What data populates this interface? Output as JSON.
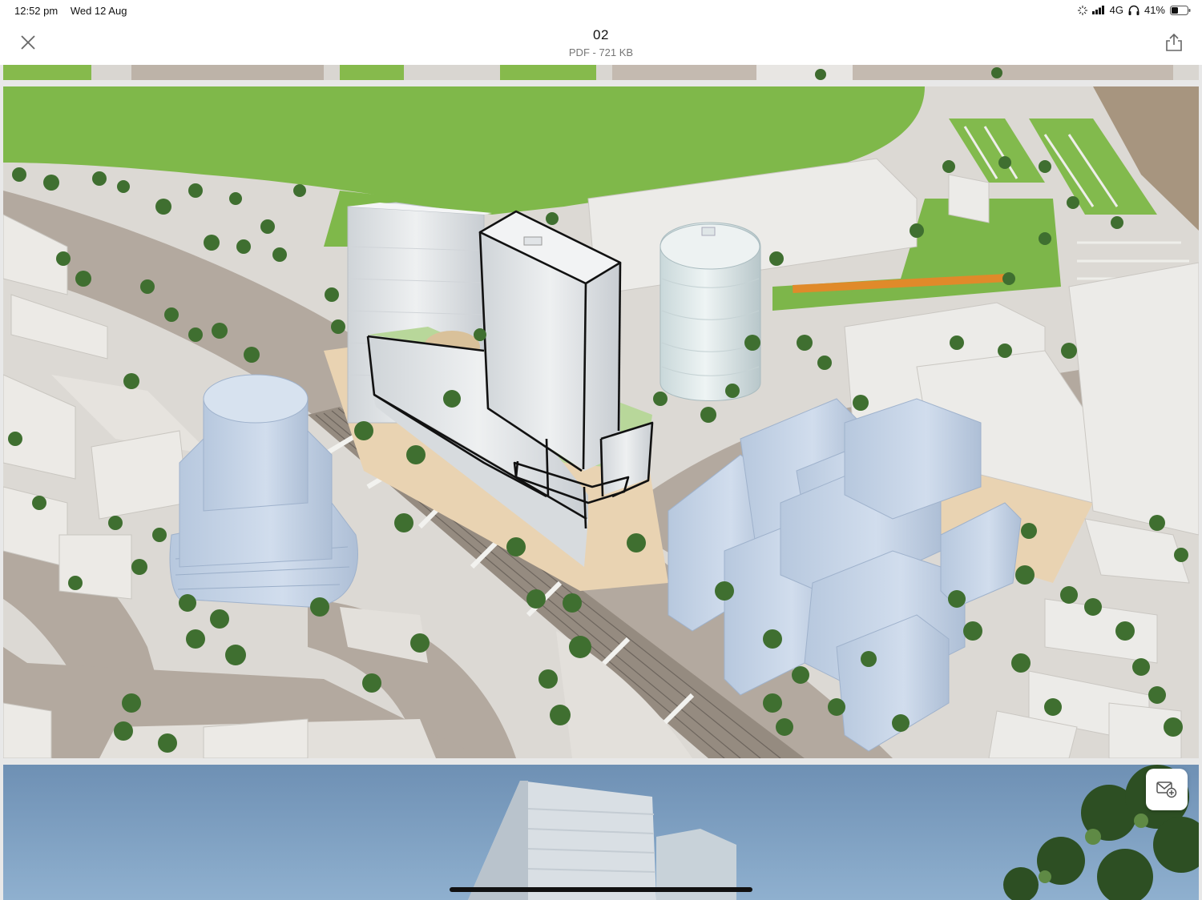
{
  "status": {
    "time": "12:52 pm",
    "date": "Wed 12 Aug",
    "network": "4G",
    "battery": "41%",
    "icons": [
      "activity-icon",
      "signal-icon",
      "headphones-icon",
      "battery-icon"
    ]
  },
  "header": {
    "title": "02",
    "subtitle": "PDF - 721 KB",
    "close_icon": "close-icon",
    "share_icon": "share-icon"
  },
  "document": {
    "pages": [
      {
        "name": "previous-page-render"
      },
      {
        "name": "architectural-site-render"
      },
      {
        "name": "next-page-render"
      }
    ]
  },
  "actions": {
    "email_add_icon": "email-add-icon"
  },
  "colors": {
    "accent": "#1a73e8",
    "grass": "#7fb54a",
    "road": "#b3a89e",
    "pavement": "#dddad5",
    "building_blue": "#c4d3e6",
    "building_white": "#e6e7e9",
    "sky": "#7a9dbf"
  }
}
